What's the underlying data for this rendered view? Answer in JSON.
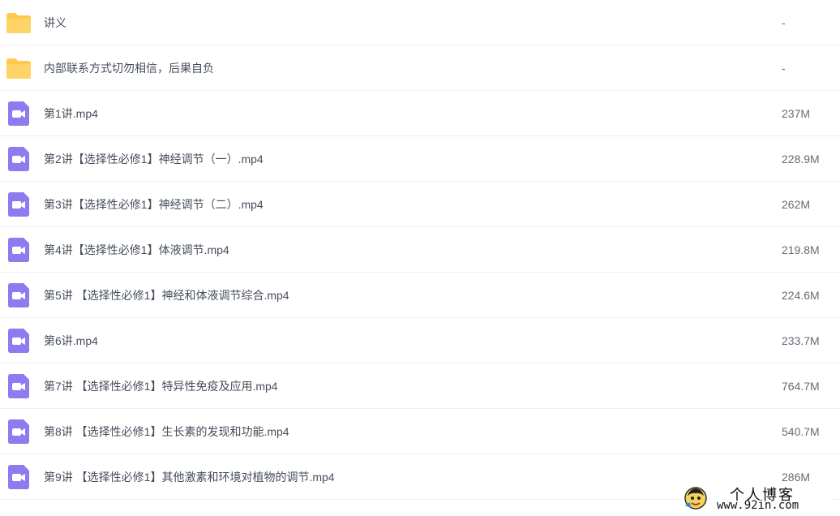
{
  "files": [
    {
      "name": "讲义",
      "size": "-",
      "type": "folder"
    },
    {
      "name": "内部联系方式切勿相信，后果自负",
      "size": "-",
      "type": "folder"
    },
    {
      "name": "第1讲.mp4",
      "size": "237M",
      "type": "video"
    },
    {
      "name": "第2讲【选择性必修1】神经调节（一）.mp4",
      "size": "228.9M",
      "type": "video"
    },
    {
      "name": "第3讲【选择性必修1】神经调节（二）.mp4",
      "size": "262M",
      "type": "video"
    },
    {
      "name": "第4讲【选择性必修1】体液调节.mp4",
      "size": "219.8M",
      "type": "video"
    },
    {
      "name": "第5讲 【选择性必修1】神经和体液调节综合.mp4",
      "size": "224.6M",
      "type": "video"
    },
    {
      "name": "第6讲.mp4",
      "size": "233.7M",
      "type": "video"
    },
    {
      "name": "第7讲 【选择性必修1】特异性免疫及应用.mp4",
      "size": "764.7M",
      "type": "video"
    },
    {
      "name": "第8讲 【选择性必修1】生长素的发现和功能.mp4",
      "size": "540.7M",
      "type": "video"
    },
    {
      "name": "第9讲 【选择性必修1】其他激素和环境对植物的调节.mp4",
      "size": "286M",
      "type": "video"
    }
  ],
  "watermark": {
    "title": "个人博客",
    "url": "www.92in.com"
  },
  "colors": {
    "folder": "#ffc94d",
    "video": "#8c7cf0",
    "text": "#454d5a",
    "divider": "#eef0f4"
  },
  "icons": {
    "folder": "folder-icon",
    "video": "video-file-icon"
  }
}
